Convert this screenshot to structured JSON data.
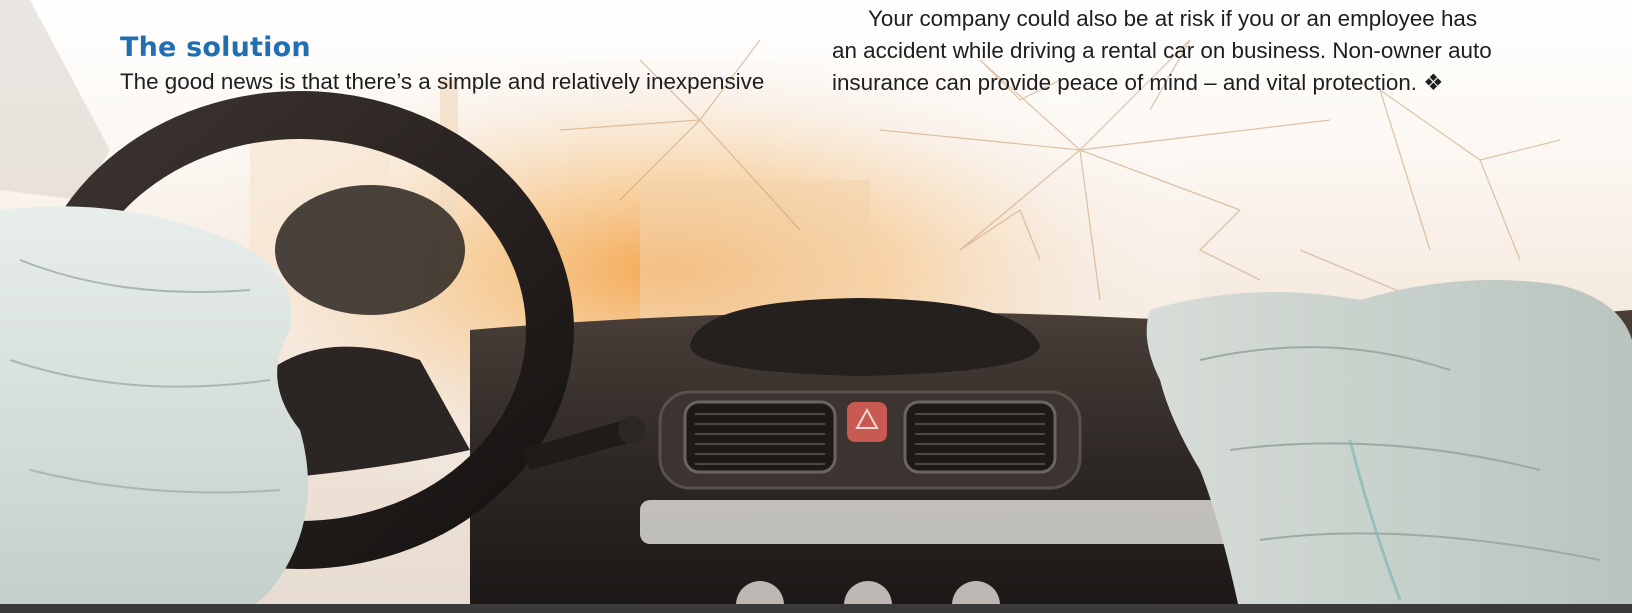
{
  "article": {
    "heading": "The solution",
    "left_column": {
      "lines": [
        "The good news is that there’s a simple and relatively inexpensive"
      ]
    },
    "right_column": {
      "lines": [
        "Your company could also be at risk if you or an employee has",
        "an accident while driving a rental car on business. Non-owner auto",
        "insurance can provide peace of mind – and vital protection. ❖"
      ]
    }
  },
  "photo": {
    "subject": "car-crash-interior-photo",
    "colors": {
      "glow": "#f3a34a",
      "dashboard": "#2d2826",
      "airbag": "#d9e3df",
      "glass": "#efefe9"
    }
  }
}
